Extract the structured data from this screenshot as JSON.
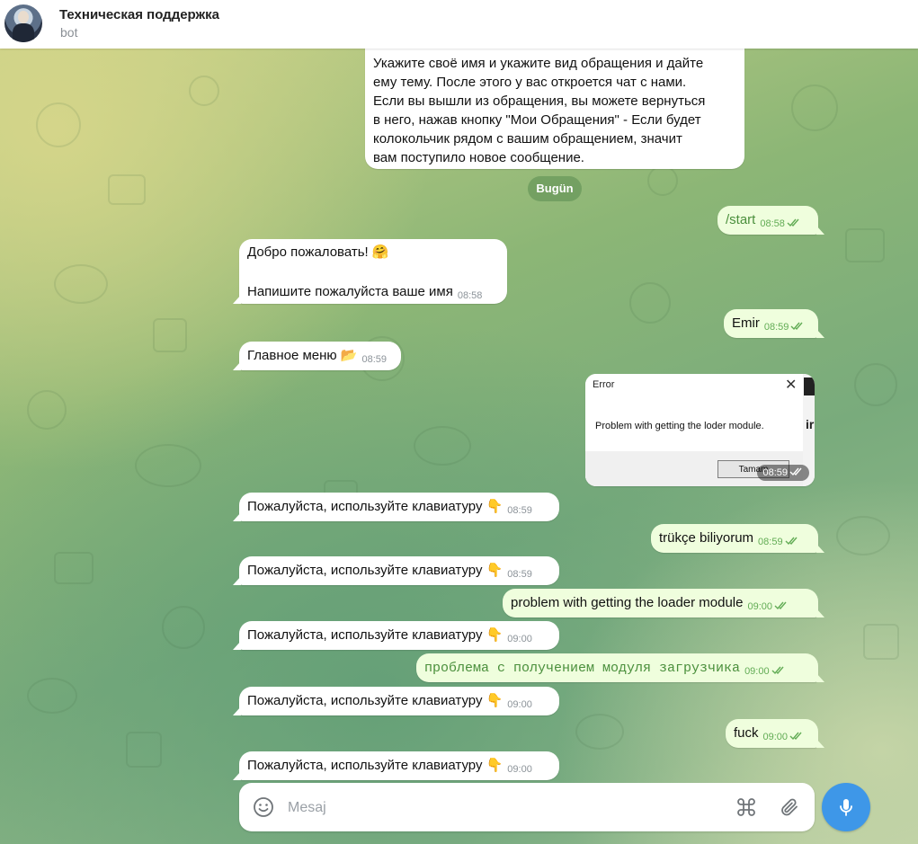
{
  "header": {
    "title": "Техническая поддержка",
    "subtitle": "bot"
  },
  "date_separator": "Bugün",
  "messages": [
    {
      "side": "in",
      "lines": [
        "Укажите своё имя и укажите вид обращения и дайте",
        "ему тему. После этого у вас откроется чат с нами.",
        "Если вы вышли из обращения, вы можете вернуться",
        "в него, нажав кнопку \"Мои Обращения\" - Если будет",
        "колокольчик рядом с вашим обращением, значит",
        "вам поступило новое сообщение."
      ]
    },
    {
      "side": "out",
      "text": "/start",
      "time": "08:58",
      "read": true
    },
    {
      "side": "in",
      "line1": "Добро пожаловать! 🤗",
      "line2": "Напишите пожалуйста ваше имя",
      "time": "08:58"
    },
    {
      "side": "out",
      "text": "Emir",
      "time": "08:59",
      "read": true
    },
    {
      "side": "in",
      "text": "Главное меню 📂",
      "time": "08:59"
    },
    {
      "side": "out",
      "type": "image",
      "time": "08:59",
      "read": true,
      "image": {
        "dialog_title": "Error",
        "message": "Problem with getting the loder module.",
        "button": "Tamam",
        "close": "✕",
        "side_letter": "ir"
      }
    },
    {
      "side": "in",
      "text": "Пожалуйста, используйте клавиатуру 👇",
      "time": "08:59"
    },
    {
      "side": "out",
      "text": "trükçe biliyorum",
      "time": "08:59",
      "read": true
    },
    {
      "side": "in",
      "text": "Пожалуйста, используйте клавиатуру 👇",
      "time": "08:59"
    },
    {
      "side": "out",
      "text": "problem with getting the loader module",
      "time": "09:00",
      "read": true
    },
    {
      "side": "in",
      "text": "Пожалуйста, используйте клавиатуру 👇",
      "time": "09:00"
    },
    {
      "side": "out",
      "text": "проблема с получением модуля загрузчика",
      "time": "09:00",
      "read": true,
      "monospace": true
    },
    {
      "side": "in",
      "text": "Пожалуйста, используйте клавиатуру 👇",
      "time": "09:00"
    },
    {
      "side": "out",
      "text": "fuck",
      "time": "09:00",
      "read": true
    },
    {
      "side": "in",
      "text": "Пожалуйста, используйте клавиатуру 👇",
      "time": "09:00"
    }
  ],
  "composer": {
    "placeholder": "Mesaj",
    "value": ""
  },
  "icons": {
    "emoji": "smile-icon",
    "bot_commands": "command-icon",
    "attach": "paperclip-icon",
    "voice": "microphone-icon",
    "read_receipt": "double-check-icon"
  },
  "colors": {
    "incoming_bubble": "#ffffff",
    "outgoing_bubble": "#effedd",
    "accent": "#3e97e8",
    "outgoing_time": "#62ac55"
  }
}
